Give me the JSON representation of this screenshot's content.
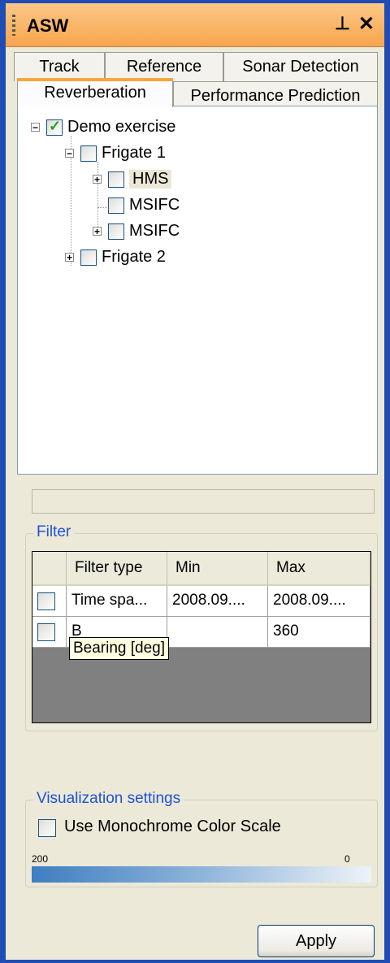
{
  "title": "ASW",
  "controls": {
    "pin": "ᵖ",
    "close": "✕"
  },
  "tabs": {
    "track": "Track",
    "reference": "Reference",
    "sonar": "Sonar Detection",
    "reverberation": "Reverberation",
    "performance": "Performance Prediction"
  },
  "tree": {
    "root": "Demo exercise",
    "frigate1": "Frigate 1",
    "hms": "HMS",
    "msifc1": "MSIFC",
    "msifc2": "MSIFC",
    "frigate2": "Frigate 2"
  },
  "filter": {
    "legend": "Filter",
    "headers": {
      "type": "Filter type",
      "min": "Min",
      "max": "Max"
    },
    "rows": [
      {
        "type": "Time spa...",
        "min": "2008.09....",
        "max": "2008.09....",
        "checked": false
      },
      {
        "type": "B",
        "min": "",
        "max": "360",
        "checked": false
      }
    ],
    "tooltip": "Bearing [deg]"
  },
  "visualization": {
    "legend": "Visualization settings",
    "monochrome_label": "Use Monochrome Color Scale",
    "scale_min": "200",
    "scale_max": "0"
  },
  "apply": "Apply",
  "colors": {
    "titlebar": "#f7a54d",
    "accent": "#1f52d6",
    "scale_start": "#3e7ec1",
    "scale_end": "#eef3f8"
  }
}
